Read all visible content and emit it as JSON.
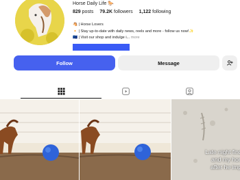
{
  "profile": {
    "username": "Horse Daily Life",
    "username_emoji": "🐎",
    "posts_count": "829",
    "posts_label": "posts",
    "followers_count": "79.2K",
    "followers_label": "followers",
    "following_count": "1,122",
    "following_label": "following"
  },
  "bio": {
    "line1": "🐴 | Horse Lovers",
    "line2": "🔸 | Stay up-to-date with daily news, reels and more - follow us now!✨",
    "line3": "🇪🇺 | Visit our shop and indulge i...",
    "more": "more"
  },
  "actions": {
    "follow": "Follow",
    "message": "Message"
  },
  "tabs": [
    "posts-grid",
    "reels",
    "tagged"
  ],
  "posts": [
    {
      "type": "image",
      "icon": "horse-with-ball"
    },
    {
      "type": "image",
      "icon": "horse-with-ball"
    },
    {
      "type": "reel",
      "caption_line1": "Late night finds but in",
      "caption_line2": "and my horse shak",
      "caption_line3": "after he impaled hir"
    }
  ],
  "colors": {
    "accent": "#4661ef",
    "link_bar": "#3a5bf5",
    "button_grey": "#efefef"
  }
}
